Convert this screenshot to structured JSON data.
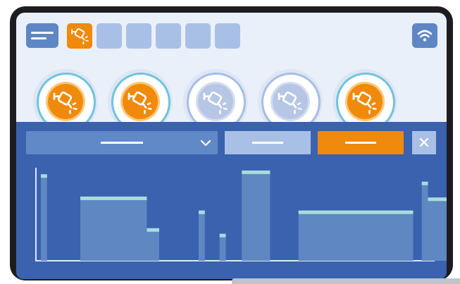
{
  "toolbar": {
    "menu_icon": "hamburger-menu-icon",
    "slots": [
      {
        "state": "on",
        "icon": "plug-icon"
      },
      {
        "state": "off"
      },
      {
        "state": "off"
      },
      {
        "state": "off"
      },
      {
        "state": "off"
      },
      {
        "state": "off"
      }
    ],
    "wifi_icon": "wifi-icon"
  },
  "dials": [
    {
      "state": "active",
      "icon": "plug-icon"
    },
    {
      "state": "active",
      "icon": "plug-icon"
    },
    {
      "state": "idle",
      "icon": "plug-icon"
    },
    {
      "state": "idle",
      "icon": "plug-icon"
    },
    {
      "state": "active",
      "icon": "plug-icon"
    }
  ],
  "controls": {
    "dropdown_icon": "chevron-down-icon",
    "close_icon": "close-icon"
  },
  "colors": {
    "accent": "#f08a0c",
    "panel": "#3a62ae",
    "bar": "#5f87c2",
    "bar_top": "#a8dcdc"
  },
  "chart_data": {
    "type": "bar",
    "ylim": [
      0,
      100
    ],
    "bars": [
      {
        "start": 2,
        "end": 4.5,
        "value": 93
      },
      {
        "start": 18,
        "end": 45,
        "value": 69
      },
      {
        "start": 45,
        "end": 50,
        "value": 35
      },
      {
        "start": 66,
        "end": 68.5,
        "value": 54
      },
      {
        "start": 74.5,
        "end": 77,
        "value": 29
      },
      {
        "start": 83.5,
        "end": 95,
        "value": 97
      },
      {
        "start": 106.5,
        "end": 153,
        "value": 54
      },
      {
        "start": 156.5,
        "end": 159,
        "value": 85
      },
      {
        "start": 159,
        "end": 167,
        "value": 68
      }
    ]
  }
}
